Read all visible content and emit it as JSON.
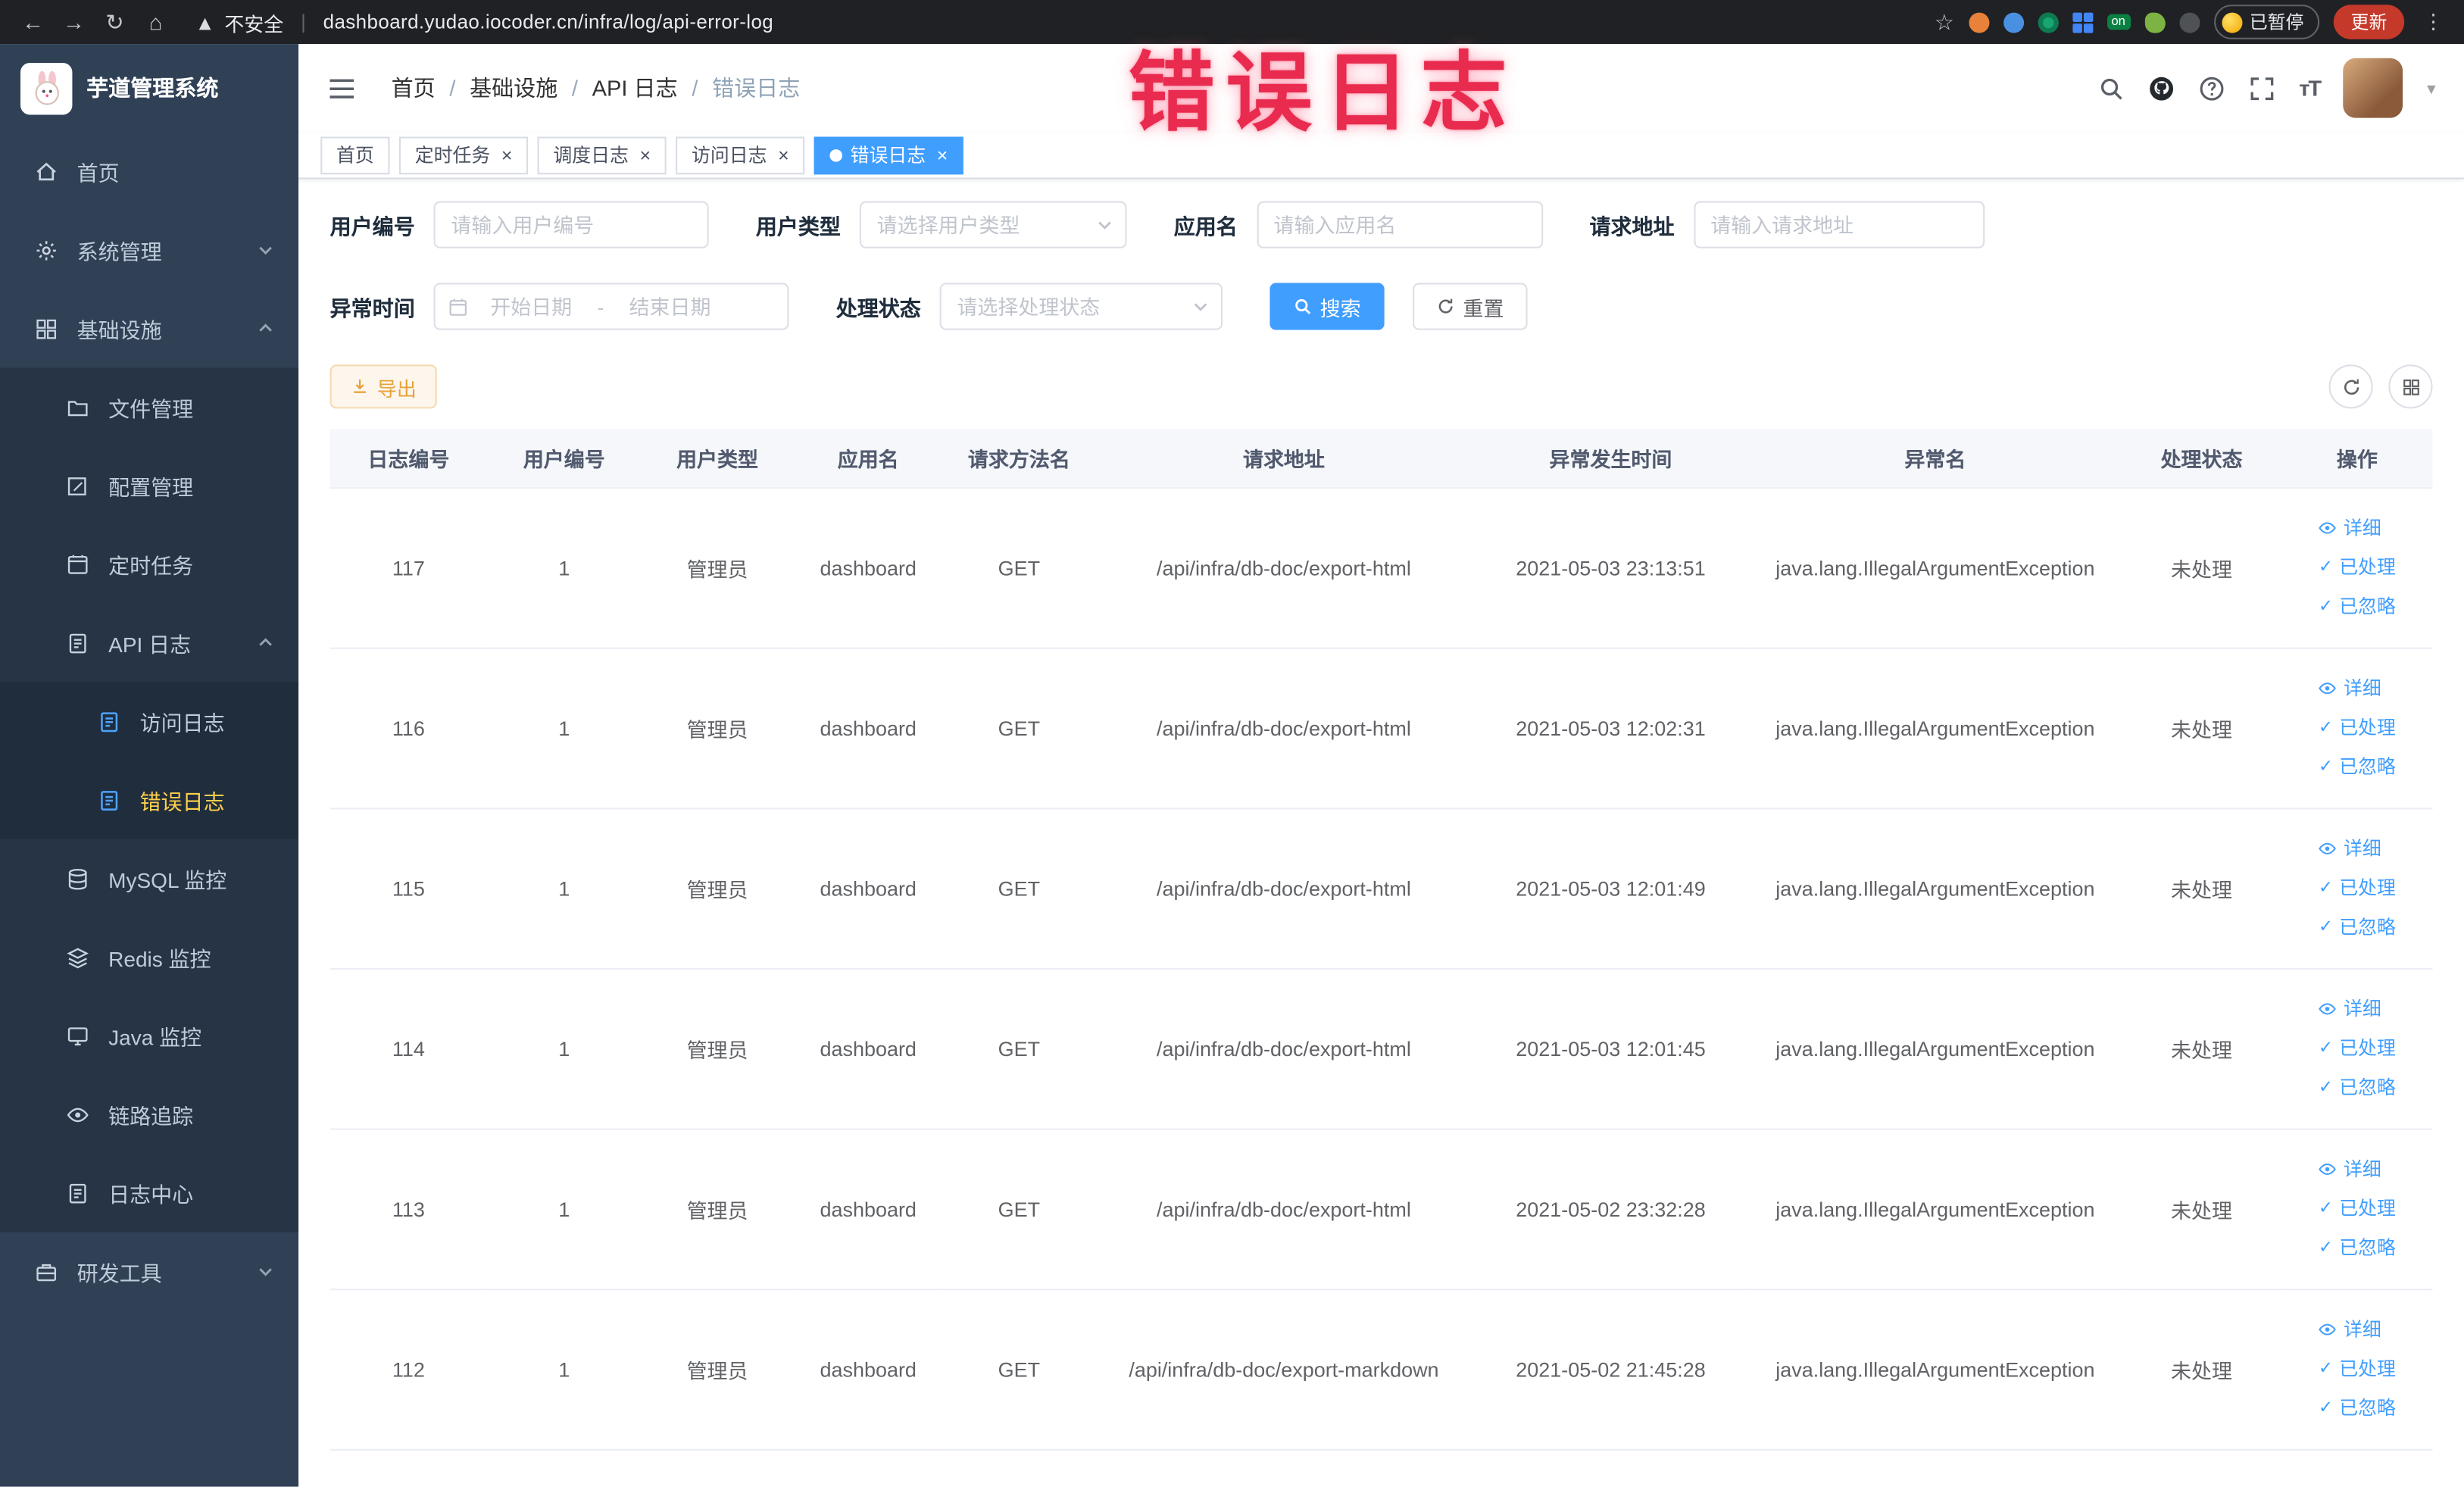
{
  "browser": {
    "security_label": "不安全",
    "url": "dashboard.yudao.iocoder.cn/infra/log/api-error-log",
    "on_badge": "on",
    "paused_button": "已暂停",
    "update_button": "更新"
  },
  "sidebar": {
    "app_title": "芋道管理系统",
    "items": [
      {
        "label": "首页"
      },
      {
        "label": "系统管理"
      },
      {
        "label": "基础设施"
      },
      {
        "label": "文件管理"
      },
      {
        "label": "配置管理"
      },
      {
        "label": "定时任务"
      },
      {
        "label": "API 日志"
      },
      {
        "label": "访问日志"
      },
      {
        "label": "错误日志"
      },
      {
        "label": "MySQL 监控"
      },
      {
        "label": "Redis 监控"
      },
      {
        "label": "Java 监控"
      },
      {
        "label": "链路追踪"
      },
      {
        "label": "日志中心"
      },
      {
        "label": "研发工具"
      }
    ]
  },
  "breadcrumb": {
    "separator": "/",
    "items": [
      "首页",
      "基础设施",
      "API 日志",
      "错误日志"
    ]
  },
  "overlay": {
    "watermark": "错误日志"
  },
  "tabs": [
    {
      "label": "首页"
    },
    {
      "label": "定时任务"
    },
    {
      "label": "调度日志"
    },
    {
      "label": "访问日志"
    },
    {
      "label": "错误日志"
    }
  ],
  "filters": {
    "user_id": {
      "label": "用户编号",
      "placeholder": "请输入用户编号"
    },
    "user_type": {
      "label": "用户类型",
      "placeholder": "请选择用户类型"
    },
    "app_name": {
      "label": "应用名",
      "placeholder": "请输入应用名"
    },
    "request_url": {
      "label": "请求地址",
      "placeholder": "请输入请求地址"
    },
    "exception_time": {
      "label": "异常时间",
      "start_placeholder": "开始日期",
      "separator": "-",
      "end_placeholder": "结束日期"
    },
    "process_status": {
      "label": "处理状态",
      "placeholder": "请选择处理状态"
    },
    "search_button": "搜索",
    "reset_button": "重置"
  },
  "toolbar": {
    "export_button": "导出"
  },
  "table": {
    "columns": [
      "日志编号",
      "用户编号",
      "用户类型",
      "应用名",
      "请求方法名",
      "请求地址",
      "异常发生时间",
      "异常名",
      "处理状态",
      "操作"
    ],
    "actions": {
      "detail": "详细",
      "processed": "已处理",
      "ignored": "已忽略"
    },
    "rows": [
      {
        "log_id": "117",
        "user_id": "1",
        "user_type": "管理员",
        "app_name": "dashboard",
        "method": "GET",
        "url": "/api/infra/db-doc/export-html",
        "time": "2021-05-03 23:13:51",
        "exception": "java.lang.IllegalArgumentException",
        "status": "未处理"
      },
      {
        "log_id": "116",
        "user_id": "1",
        "user_type": "管理员",
        "app_name": "dashboard",
        "method": "GET",
        "url": "/api/infra/db-doc/export-html",
        "time": "2021-05-03 12:02:31",
        "exception": "java.lang.IllegalArgumentException",
        "status": "未处理"
      },
      {
        "log_id": "115",
        "user_id": "1",
        "user_type": "管理员",
        "app_name": "dashboard",
        "method": "GET",
        "url": "/api/infra/db-doc/export-html",
        "time": "2021-05-03 12:01:49",
        "exception": "java.lang.IllegalArgumentException",
        "status": "未处理"
      },
      {
        "log_id": "114",
        "user_id": "1",
        "user_type": "管理员",
        "app_name": "dashboard",
        "method": "GET",
        "url": "/api/infra/db-doc/export-html",
        "time": "2021-05-03 12:01:45",
        "exception": "java.lang.IllegalArgumentException",
        "status": "未处理"
      },
      {
        "log_id": "113",
        "user_id": "1",
        "user_type": "管理员",
        "app_name": "dashboard",
        "method": "GET",
        "url": "/api/infra/db-doc/export-html",
        "time": "2021-05-02 23:32:28",
        "exception": "java.lang.IllegalArgumentException",
        "status": "未处理"
      },
      {
        "log_id": "112",
        "user_id": "1",
        "user_type": "管理员",
        "app_name": "dashboard",
        "method": "GET",
        "url": "/api/infra/db-doc/export-markdown",
        "time": "2021-05-02 21:45:28",
        "exception": "java.lang.IllegalArgumentException",
        "status": "未处理"
      }
    ]
  },
  "colors": {
    "primary": "#409eff",
    "sidebar_bg": "#304156",
    "active_menu": "#ffd04b",
    "warning": "#e6a23c",
    "annotation_red": "#e82b4e"
  }
}
